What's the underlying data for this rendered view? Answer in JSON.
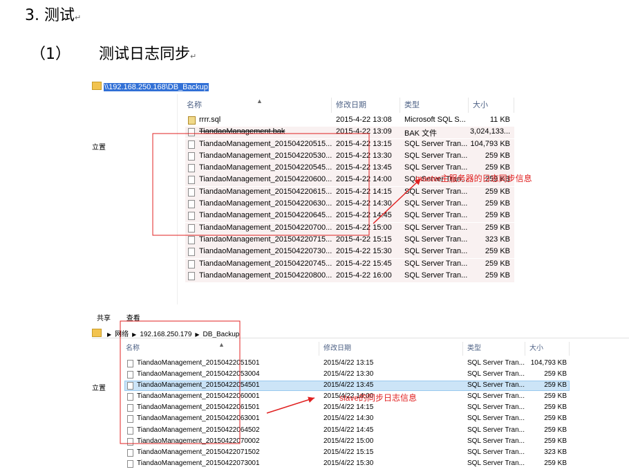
{
  "heading": {
    "number": "3.",
    "title": "测试",
    "mark": "↵"
  },
  "subheading": {
    "number": "（1）",
    "title": "测试日志同步",
    "mark": "↵"
  },
  "explorer1": {
    "address": "\\\\192.168.250.168\\DB_Backup",
    "side_label": "立置",
    "columns": [
      "名称",
      "修改日期",
      "类型",
      "大小"
    ],
    "rows": [
      {
        "name": "rrrr.sql",
        "date": "2015-4-22 13:08",
        "type": "Microsoft SQL S...",
        "size": "11 KB",
        "icon": "sql-script-icon",
        "strike": false,
        "tint": false
      },
      {
        "name": "TiandaoManagement.bak",
        "date": "2015-4-22 13:09",
        "type": "BAK 文件",
        "size": "3,024,133...",
        "icon": "file-icon",
        "strike": true,
        "tint": true
      },
      {
        "name": "TiandaoManagement_201504220515...",
        "date": "2015-4-22 13:15",
        "type": "SQL Server Tran...",
        "size": "104,793 KB",
        "icon": "file-icon",
        "strike": false,
        "tint": true
      },
      {
        "name": "TiandaoManagement_201504220530...",
        "date": "2015-4-22 13:30",
        "type": "SQL Server Tran...",
        "size": "259 KB",
        "icon": "file-icon",
        "strike": false,
        "tint": true
      },
      {
        "name": "TiandaoManagement_201504220545...",
        "date": "2015-4-22 13:45",
        "type": "SQL Server Tran...",
        "size": "259 KB",
        "icon": "file-icon",
        "strike": false,
        "tint": true
      },
      {
        "name": "TiandaoManagement_201504220600...",
        "date": "2015-4-22 14:00",
        "type": "SQL Server Tran...",
        "size": "259 KB",
        "icon": "file-icon",
        "strike": false,
        "tint": true
      },
      {
        "name": "TiandaoManagement_201504220615...",
        "date": "2015-4-22 14:15",
        "type": "SQL Server Tran...",
        "size": "259 KB",
        "icon": "file-icon",
        "strike": false,
        "tint": true
      },
      {
        "name": "TiandaoManagement_201504220630...",
        "date": "2015-4-22 14:30",
        "type": "SQL Server Tran...",
        "size": "259 KB",
        "icon": "file-icon",
        "strike": false,
        "tint": true
      },
      {
        "name": "TiandaoManagement_201504220645...",
        "date": "2015-4-22 14:45",
        "type": "SQL Server Tran...",
        "size": "259 KB",
        "icon": "file-icon",
        "strike": false,
        "tint": true
      },
      {
        "name": "TiandaoManagement_201504220700...",
        "date": "2015-4-22 15:00",
        "type": "SQL Server Tran...",
        "size": "259 KB",
        "icon": "file-icon",
        "strike": false,
        "tint": true
      },
      {
        "name": "TiandaoManagement_201504220715...",
        "date": "2015-4-22 15:15",
        "type": "SQL Server Tran...",
        "size": "323 KB",
        "icon": "file-icon",
        "strike": false,
        "tint": true
      },
      {
        "name": "TiandaoManagement_201504220730...",
        "date": "2015-4-22 15:30",
        "type": "SQL Server Tran...",
        "size": "259 KB",
        "icon": "file-icon",
        "strike": false,
        "tint": true
      },
      {
        "name": "TiandaoManagement_201504220745...",
        "date": "2015-4-22 15:45",
        "type": "SQL Server Tran...",
        "size": "259 KB",
        "icon": "file-icon",
        "strike": false,
        "tint": true
      },
      {
        "name": "TiandaoManagement_201504220800...",
        "date": "2015-4-22 16:00",
        "type": "SQL Server Tran...",
        "size": "259 KB",
        "icon": "file-icon",
        "strike": false,
        "tint": true
      }
    ],
    "annotation": "master主服务器的日志同步信息"
  },
  "explorer2": {
    "menu": [
      "共享",
      "查看"
    ],
    "breadcrumb": [
      "网络",
      "192.168.250.179",
      "DB_Backup"
    ],
    "side_label": "立置",
    "columns": [
      "名称",
      "修改日期",
      "类型",
      "大小"
    ],
    "rows": [
      {
        "name": "TiandaoManagement_20150422051501",
        "date": "2015/4/22 13:15",
        "type": "SQL Server Tran...",
        "size": "104,793 KB",
        "selected": false
      },
      {
        "name": "TiandaoManagement_20150422053004",
        "date": "2015/4/22 13:30",
        "type": "SQL Server Tran...",
        "size": "259 KB",
        "selected": false
      },
      {
        "name": "TiandaoManagement_20150422054501",
        "date": "2015/4/22 13:45",
        "type": "SQL Server Tran...",
        "size": "259 KB",
        "selected": true
      },
      {
        "name": "TiandaoManagement_20150422060001",
        "date": "2015/4/22 14:00",
        "type": "SQL Server Tran...",
        "size": "259 KB",
        "selected": false
      },
      {
        "name": "TiandaoManagement_20150422061501",
        "date": "2015/4/22 14:15",
        "type": "SQL Server Tran...",
        "size": "259 KB",
        "selected": false
      },
      {
        "name": "TiandaoManagement_20150422063001",
        "date": "2015/4/22 14:30",
        "type": "SQL Server Tran...",
        "size": "259 KB",
        "selected": false
      },
      {
        "name": "TiandaoManagement_20150422064502",
        "date": "2015/4/22 14:45",
        "type": "SQL Server Tran...",
        "size": "259 KB",
        "selected": false
      },
      {
        "name": "TiandaoManagement_20150422070002",
        "date": "2015/4/22 15:00",
        "type": "SQL Server Tran...",
        "size": "259 KB",
        "selected": false
      },
      {
        "name": "TiandaoManagement_20150422071502",
        "date": "2015/4/22 15:15",
        "type": "SQL Server Tran...",
        "size": "323 KB",
        "selected": false
      },
      {
        "name": "TiandaoManagement_20150422073001",
        "date": "2015/4/22 15:30",
        "type": "SQL Server Tran...",
        "size": "259 KB",
        "selected": false
      }
    ],
    "annotation": "slave的同步日志信息"
  },
  "colors": {
    "annotation": "#e02020",
    "selection": "#cce4f7",
    "address_highlight": "#3170d6"
  }
}
